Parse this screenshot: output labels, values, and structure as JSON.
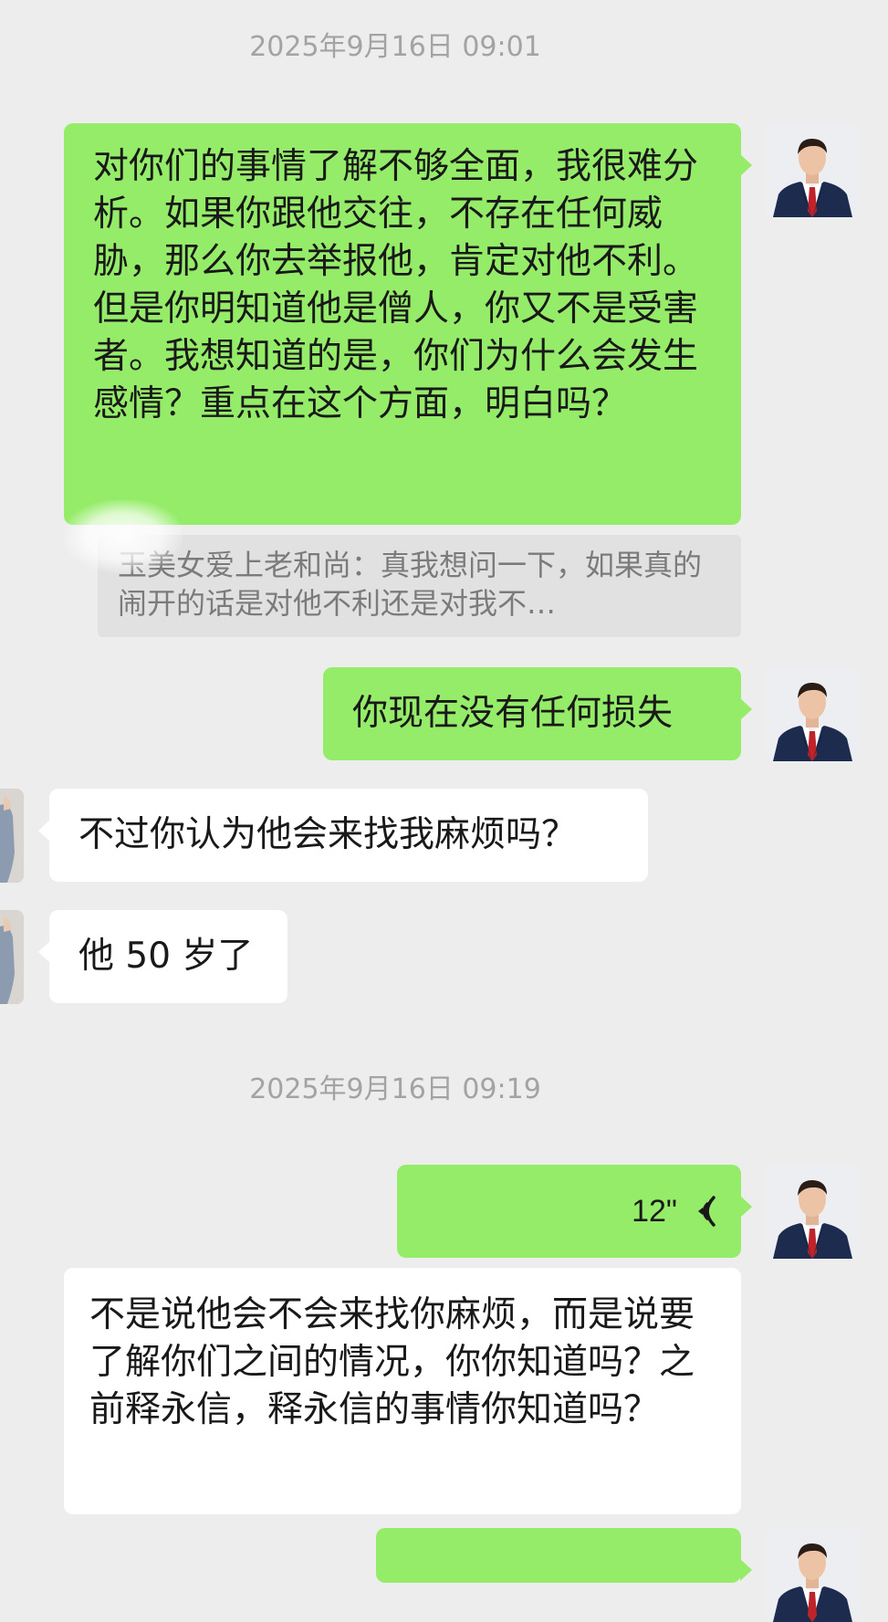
{
  "timestamps": [
    "2025年9月16日 09:01",
    "2025年9月16日 09:19"
  ],
  "messages": {
    "m1": "对你们的事情了解不够全面，我很难分析。如果你跟他交往，不存在任何威胁，那么你去举报他，肯定对他不利。但是你明知道他是僧人，你又不是受害者。我想知道的是，你们为什么会发生感情？重点在这个方面，明白吗？",
    "quote": "玉美女爱上老和尚：真我想问一下，如果真的闹开的话是对他不利还是对我不…",
    "m2": "你现在没有任何损失",
    "m3": "不过你认为他会来找我麻烦吗？",
    "m4": "他 50 岁了",
    "voice_duration": "12\"",
    "m5": "不是说他会不会来找你麻烦，而是说要了解你们之间的情况，你你知道吗？之前释永信，释永信的事情你知道吗？"
  },
  "colors": {
    "background": "#ededed",
    "sent_bubble": "#95ec69",
    "received_bubble": "#ffffff",
    "quote_bg": "#e1e1e1"
  },
  "icons": {
    "voice": "voice-wave-icon",
    "avatar_self": "man-in-suit-avatar",
    "avatar_other": "woman-photo-avatar"
  }
}
